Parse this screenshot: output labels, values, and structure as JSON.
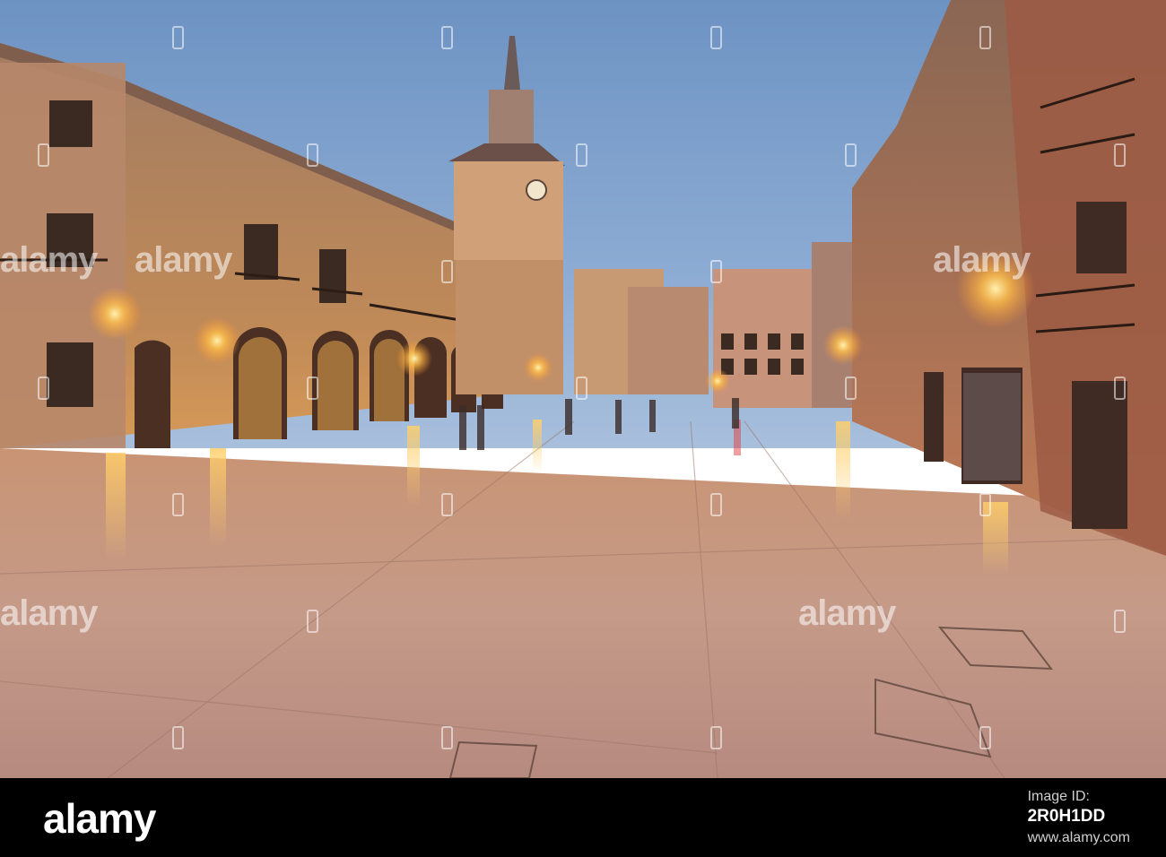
{
  "watermark": {
    "text": "alamy"
  },
  "footer": {
    "logo": "alamy",
    "image_id_label": "Image ID:",
    "image_id": "2R0H1DD",
    "url": "www.alamy.com"
  },
  "scene": {
    "subject": "illuminated town square at dusk",
    "colors": {
      "sky": "#6f94c4",
      "pavement": "#c79a86",
      "lamp": "#ffc86a",
      "stone": "#b88a64"
    }
  }
}
